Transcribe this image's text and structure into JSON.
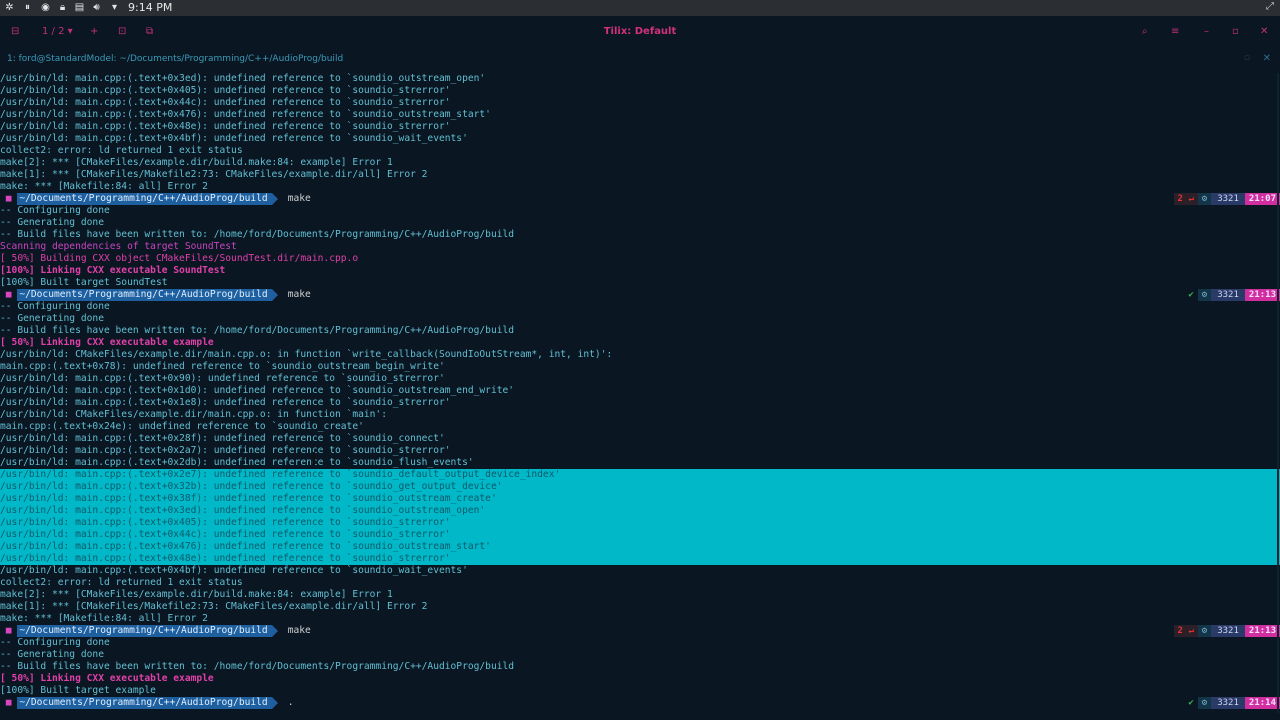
{
  "topbar": {
    "clock": "9:14 PM",
    "icons": [
      "menu-icon",
      "pause-icon",
      "discord-icon",
      "lock-icon",
      "clipboard-icon",
      "volume-icon",
      "dropdown-icon"
    ],
    "tray_icon": "expand-icon"
  },
  "titlebar": {
    "left": [
      "split-icon",
      "1 / 2",
      "add-icon",
      "new-window-icon",
      "sync-icon"
    ],
    "title": "Tilix: Default",
    "right": [
      "search-icon",
      "hamburger-icon",
      "minimize-icon",
      "maximize-icon",
      "close-icon"
    ]
  },
  "session": {
    "title": "1: ford@StandardModel: ~/Documents/Programming/C++/AudioProg/build",
    "right_icons": [
      "restore-icon",
      "close-icon"
    ]
  },
  "prompt": {
    "path": "~/Documents/Programming/C++/AudioProg/build"
  },
  "lines": [
    {
      "t": "text",
      "text": "/usr/bin/ld: main.cpp:(.text+0x3ed): undefined reference to `soundio_outstream_open'"
    },
    {
      "t": "text",
      "text": "/usr/bin/ld: main.cpp:(.text+0x405): undefined reference to `soundio_strerror'"
    },
    {
      "t": "text",
      "text": "/usr/bin/ld: main.cpp:(.text+0x44c): undefined reference to `soundio_strerror'"
    },
    {
      "t": "text",
      "text": "/usr/bin/ld: main.cpp:(.text+0x476): undefined reference to `soundio_outstream_start'"
    },
    {
      "t": "text",
      "text": "/usr/bin/ld: main.cpp:(.text+0x48e): undefined reference to `soundio_strerror'"
    },
    {
      "t": "text",
      "text": "/usr/bin/ld: main.cpp:(.text+0x4bf): undefined reference to `soundio_wait_events'"
    },
    {
      "t": "text",
      "text": "collect2: error: ld returned 1 exit status"
    },
    {
      "t": "text",
      "text": "make[2]: *** [CMakeFiles/example.dir/build.make:84: example] Error 1"
    },
    {
      "t": "text",
      "text": "make[1]: *** [CMakeFiles/Makefile2:73: CMakeFiles/example.dir/all] Error 2"
    },
    {
      "t": "text",
      "text": "make: *** [Makefile:84: all] Error 2"
    },
    {
      "t": "prompt",
      "cmd": "make",
      "err": "2 ↵",
      "num": "3321",
      "time": "21:07"
    },
    {
      "t": "text",
      "text": "-- Configuring done"
    },
    {
      "t": "text",
      "text": "-- Generating done"
    },
    {
      "t": "text",
      "text": "-- Build files have been written to: /home/ford/Documents/Programming/C++/AudioProg/build"
    },
    {
      "t": "text",
      "style": "purple",
      "text": "Scanning dependencies of target SoundTest"
    },
    {
      "t": "text",
      "style": "magenta",
      "text": "[ 50%] Building CXX object CMakeFiles/SoundTest.dir/main.cpp.o"
    },
    {
      "t": "text",
      "style": "mag-b",
      "text": "[100%] Linking CXX executable SoundTest"
    },
    {
      "t": "text",
      "text": "[100%] Built target SoundTest"
    },
    {
      "t": "prompt",
      "cmd": "make",
      "ok": "✔",
      "num": "3321",
      "time": "21:13"
    },
    {
      "t": "text",
      "text": "-- Configuring done"
    },
    {
      "t": "text",
      "text": "-- Generating done"
    },
    {
      "t": "text",
      "text": "-- Build files have been written to: /home/ford/Documents/Programming/C++/AudioProg/build"
    },
    {
      "t": "text",
      "style": "mag-b",
      "text": "[ 50%] Linking CXX executable example"
    },
    {
      "t": "text",
      "text": "/usr/bin/ld: CMakeFiles/example.dir/main.cpp.o: in function `write_callback(SoundIoOutStream*, int, int)':"
    },
    {
      "t": "text",
      "text": "main.cpp:(.text+0x78): undefined reference to `soundio_outstream_begin_write'"
    },
    {
      "t": "text",
      "text": "/usr/bin/ld: main.cpp:(.text+0x90): undefined reference to `soundio_strerror'"
    },
    {
      "t": "text",
      "text": "/usr/bin/ld: main.cpp:(.text+0x1d0): undefined reference to `soundio_outstream_end_write'"
    },
    {
      "t": "text",
      "text": "/usr/bin/ld: main.cpp:(.text+0x1e8): undefined reference to `soundio_strerror'"
    },
    {
      "t": "text",
      "text": "/usr/bin/ld: CMakeFiles/example.dir/main.cpp.o: in function `main':"
    },
    {
      "t": "text",
      "text": "main.cpp:(.text+0x24e): undefined reference to `soundio_create'"
    },
    {
      "t": "text",
      "text": "/usr/bin/ld: main.cpp:(.text+0x28f): undefined reference to `soundio_connect'"
    },
    {
      "t": "text",
      "text": "/usr/bin/ld: main.cpp:(.text+0x2a7): undefined reference to `soundio_strerror'"
    },
    {
      "t": "text",
      "text": "/usr/bin/ld: main.cpp:(.text+0x2db): undefined reference to `soundio_flush_events'"
    },
    {
      "t": "text",
      "sel": true,
      "text": "/usr/bin/ld: main.cpp:(.text+0x2e7): undefined reference to `soundio_default_output_device_index'"
    },
    {
      "t": "text",
      "sel": true,
      "text": "/usr/bin/ld: main.cpp:(.text+0x32b): undefined reference to `soundio_get_output_device'"
    },
    {
      "t": "text",
      "sel": true,
      "text": "/usr/bin/ld: main.cpp:(.text+0x38f): undefined reference to `soundio_outstream_create'"
    },
    {
      "t": "text",
      "sel": true,
      "text": "/usr/bin/ld: main.cpp:(.text+0x3ed): undefined reference to `soundio_outstream_open'"
    },
    {
      "t": "text",
      "sel": true,
      "text": "/usr/bin/ld: main.cpp:(.text+0x405): undefined reference to `soundio_strerror'"
    },
    {
      "t": "text",
      "sel": true,
      "text": "/usr/bin/ld: main.cpp:(.text+0x44c): undefined reference to `soundio_strerror'"
    },
    {
      "t": "text",
      "sel": true,
      "text": "/usr/bin/ld: main.cpp:(.text+0x476): undefined reference to `soundio_outstream_start'"
    },
    {
      "t": "text",
      "sel": true,
      "text": "/usr/bin/ld: main.cpp:(.text+0x48e): undefined reference to `soundio_strerror'"
    },
    {
      "t": "text",
      "text": "/usr/bin/ld: main.cpp:(.text+0x4bf): undefined reference to `soundio_wait_events'"
    },
    {
      "t": "text",
      "text": "collect2: error: ld returned 1 exit status"
    },
    {
      "t": "text",
      "text": "make[2]: *** [CMakeFiles/example.dir/build.make:84: example] Error 1"
    },
    {
      "t": "text",
      "text": "make[1]: *** [CMakeFiles/Makefile2:73: CMakeFiles/example.dir/all] Error 2"
    },
    {
      "t": "text",
      "text": "make: *** [Makefile:84: all] Error 2"
    },
    {
      "t": "prompt",
      "cmd": "make",
      "err": "2 ↵",
      "num": "3321",
      "time": "21:13"
    },
    {
      "t": "text",
      "text": "-- Configuring done"
    },
    {
      "t": "text",
      "text": "-- Generating done"
    },
    {
      "t": "text",
      "text": "-- Build files have been written to: /home/ford/Documents/Programming/C++/AudioProg/build"
    },
    {
      "t": "text",
      "style": "mag-b",
      "text": "[ 50%] Linking CXX executable example"
    },
    {
      "t": "text",
      "text": "[100%] Built target example"
    },
    {
      "t": "prompt",
      "cmd": ".",
      "ok": "✔",
      "num": "3321",
      "time": "21:14"
    }
  ]
}
